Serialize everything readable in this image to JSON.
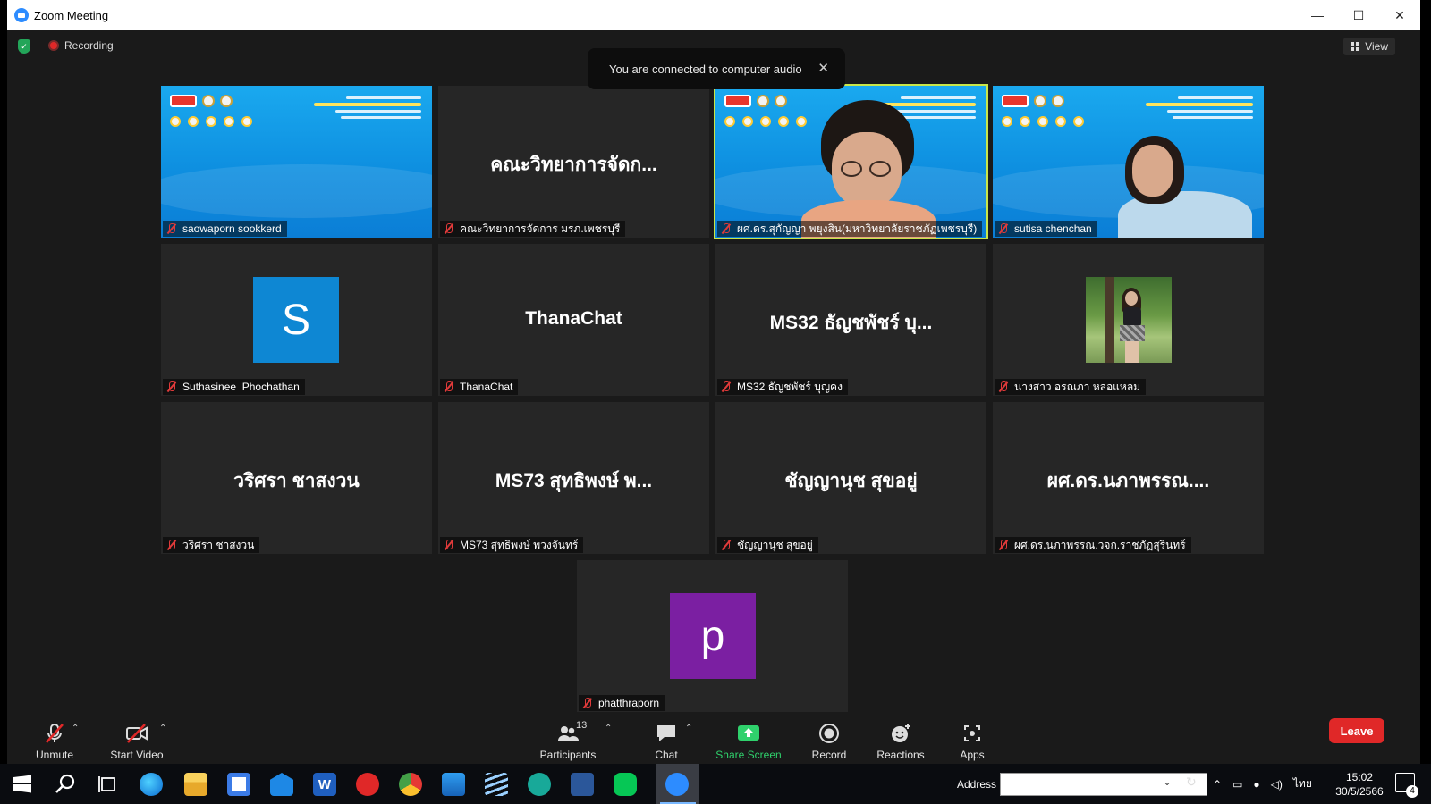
{
  "window": {
    "title": "Zoom Meeting",
    "controls": {
      "minimize": "—",
      "maximize": "☐",
      "close": "✕"
    }
  },
  "topbar": {
    "recording_label": "Recording",
    "view_label": "View"
  },
  "toast": {
    "message": "You are connected to computer audio",
    "close": "✕"
  },
  "tiles": [
    {
      "name": "saowaporn sookkerd",
      "kind": "video-banner",
      "muted": true
    },
    {
      "name": "คณะวิทยาการจัดการ มรภ.เพชรบุรี",
      "display": "คณะวิทยาการจัดก...",
      "kind": "name-only",
      "muted": true
    },
    {
      "name": "ผศ.ดร.สุกัญญา พยุงสิน(มหาวิทยาลัยราชภัฏเพชรบุรี)",
      "kind": "video-speaker",
      "muted": true,
      "active": true
    },
    {
      "name": "sutisa chenchan",
      "kind": "video-person",
      "muted": true
    },
    {
      "name": "Suthasinee  Phochathan",
      "kind": "avatar-letter",
      "letter": "S",
      "avatar_color": "#0e87d3",
      "muted": true
    },
    {
      "name": "ThanaChat",
      "display": "ThanaChat",
      "kind": "name-only",
      "muted": true
    },
    {
      "name": "MS32 ธัญชพัชร์ บุญคง",
      "display": "MS32 ธัญชพัชร์ บุ...",
      "kind": "name-only",
      "muted": true
    },
    {
      "name": "นางสาว อรณภา หล่อแหลม",
      "kind": "photo",
      "muted": true
    },
    {
      "name": "วริศรา ชาสงวน",
      "display": "วริศรา ชาสงวน",
      "kind": "name-only",
      "muted": true
    },
    {
      "name": "MS73 สุทธิพงษ์ พวงจันทร์",
      "display": "MS73 สุทธิพงษ์ พ...",
      "kind": "name-only",
      "muted": true
    },
    {
      "name": "ชัญญานุช สุขอยู่",
      "display": "ชัญญานุช สุขอยู่",
      "kind": "name-only",
      "muted": true
    },
    {
      "name": "ผศ.ดร.นภาพรรณ.วจก.ราชภัฏสุรินทร์",
      "display": "ผศ.ดร.นภาพรรณ....",
      "kind": "name-only",
      "muted": true
    },
    {
      "name": "phatthraporn",
      "kind": "avatar-letter",
      "letter": "p",
      "avatar_color": "#7b1fa2",
      "muted": true
    }
  ],
  "toolbar": {
    "unmute": "Unmute",
    "start_video": "Start Video",
    "participants": "Participants",
    "participants_count": "13",
    "chat": "Chat",
    "share_screen": "Share Screen",
    "record": "Record",
    "reactions": "Reactions",
    "apps": "Apps",
    "leave": "Leave",
    "caret": "⌃"
  },
  "taskbar": {
    "address_label": "Address",
    "language": "ไทย",
    "time": "15:02",
    "date": "30/5/2566",
    "notification_count": "4"
  },
  "colors": {
    "accent_active_speaker": "#c8e64a",
    "leave": "#e02828",
    "share_green": "#2fd16c"
  }
}
